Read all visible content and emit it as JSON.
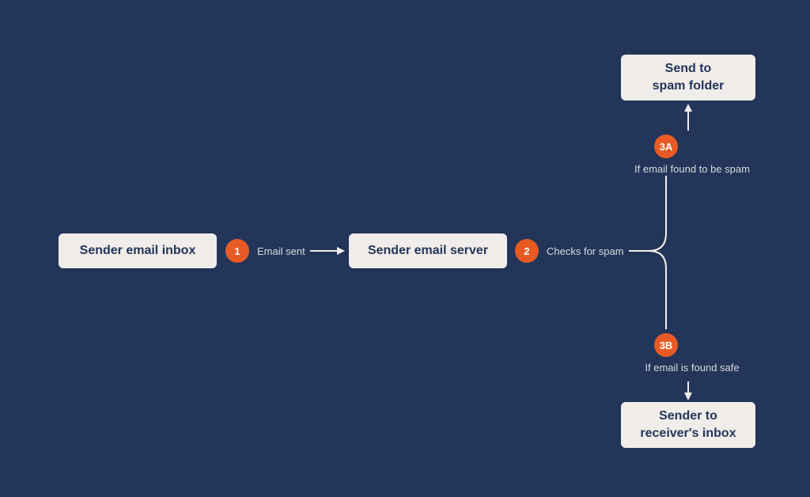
{
  "colors": {
    "background": "#233659",
    "box_bg": "#f0edea",
    "box_text": "#233659",
    "badge_bg": "#e85a24",
    "label_text": "#d5d9e0",
    "connector": "#f0edea"
  },
  "nodes": {
    "sender_inbox": "Sender email inbox",
    "sender_server": "Sender email server",
    "spam_folder": "Send to\nspam folder",
    "receiver_inbox": "Sender to\nreceiver's inbox"
  },
  "steps": {
    "s1": {
      "badge": "1",
      "label": "Email sent"
    },
    "s2": {
      "badge": "2",
      "label": "Checks for spam"
    },
    "s3a": {
      "badge": "3A",
      "label": "If email found to be spam"
    },
    "s3b": {
      "badge": "3B",
      "label": "If email is found safe"
    }
  }
}
